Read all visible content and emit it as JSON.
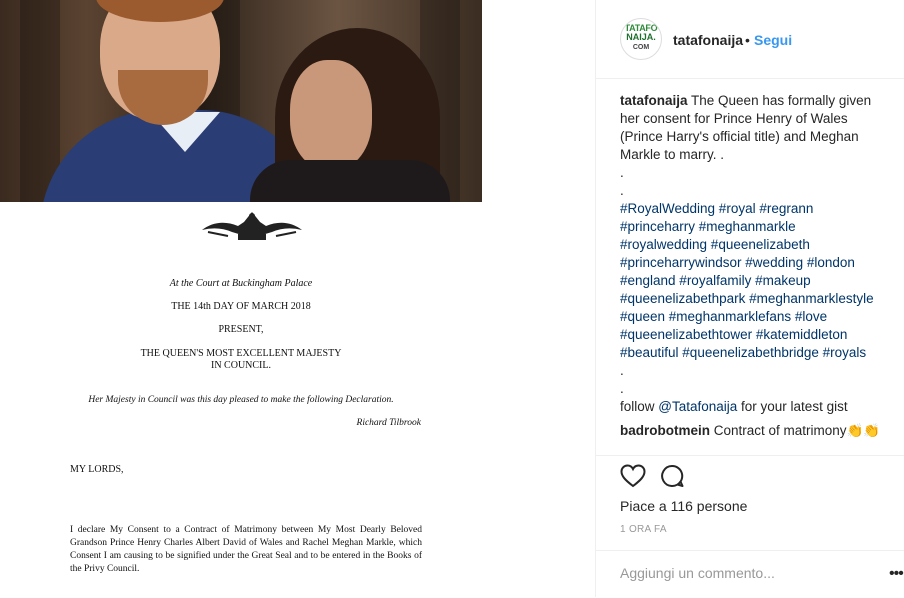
{
  "header": {
    "avatar_text_top": "TATAFO",
    "avatar_text_mid": "NAIJA.",
    "avatar_text_bot": "COM",
    "username": "tatafonaija",
    "separator": "•",
    "follow_label": "Segui"
  },
  "caption": {
    "username": "tatafonaija",
    "text": "The Queen has formally given her consent for Prince Henry of Wales (Prince Harry's official title) and Meghan Markle to marry. .",
    "dots": [
      ".",
      "."
    ],
    "hashtag_lines": [
      "#RoyalWedding #royal #regrann",
      "#princeharry #meghanmarkle",
      "#royalwedding #queenelizabeth",
      "#princeharrywindsor #wedding #london",
      "#england #royalfamily #makeup",
      "#queenelizabethpark #meghanmarklestyle",
      "#queen #meghanmarklefans #love",
      "#queenelizabethtower #katemiddleton",
      "#beautiful #queenelizabethbridge #royals"
    ],
    "dots_after": [
      ".",
      "."
    ],
    "follow_prefix": "follow ",
    "follow_mention": "@Tatafonaija",
    "follow_suffix": " for your latest gist"
  },
  "comment": {
    "username": "badrobotmein",
    "text": "Contract of matrimony",
    "emoji": "👏👏"
  },
  "actions": {
    "like_icon": "heart-icon",
    "comment_icon": "comment-bubble-icon",
    "likes_text": "Piace a 116 persone",
    "time_text": "1 ORA FA"
  },
  "add_comment": {
    "placeholder": "Aggiungi un commento...",
    "more_label": "•••"
  },
  "letter": {
    "court_line": "At the Court at Buckingham Palace",
    "date_line": "THE 14th DAY OF MARCH 2018",
    "present": "PRESENT,",
    "majesty_line1": "THE QUEEN'S MOST EXCELLENT MAJESTY",
    "majesty_line2": "IN COUNCIL.",
    "council_line": "Her Majesty in Council was this day pleased to make the following Declaration.",
    "signature": "Richard Tilbrook",
    "lords": "MY LORDS,",
    "declaration": "I declare My Consent to a Contract of Matrimony between My Most Dearly Beloved Grandson Prince Henry Charles Albert David of Wales and Rachel Meghan Markle, which Consent I am causing to be signified under the Great Seal and to be entered in the Books of the Privy Council."
  }
}
